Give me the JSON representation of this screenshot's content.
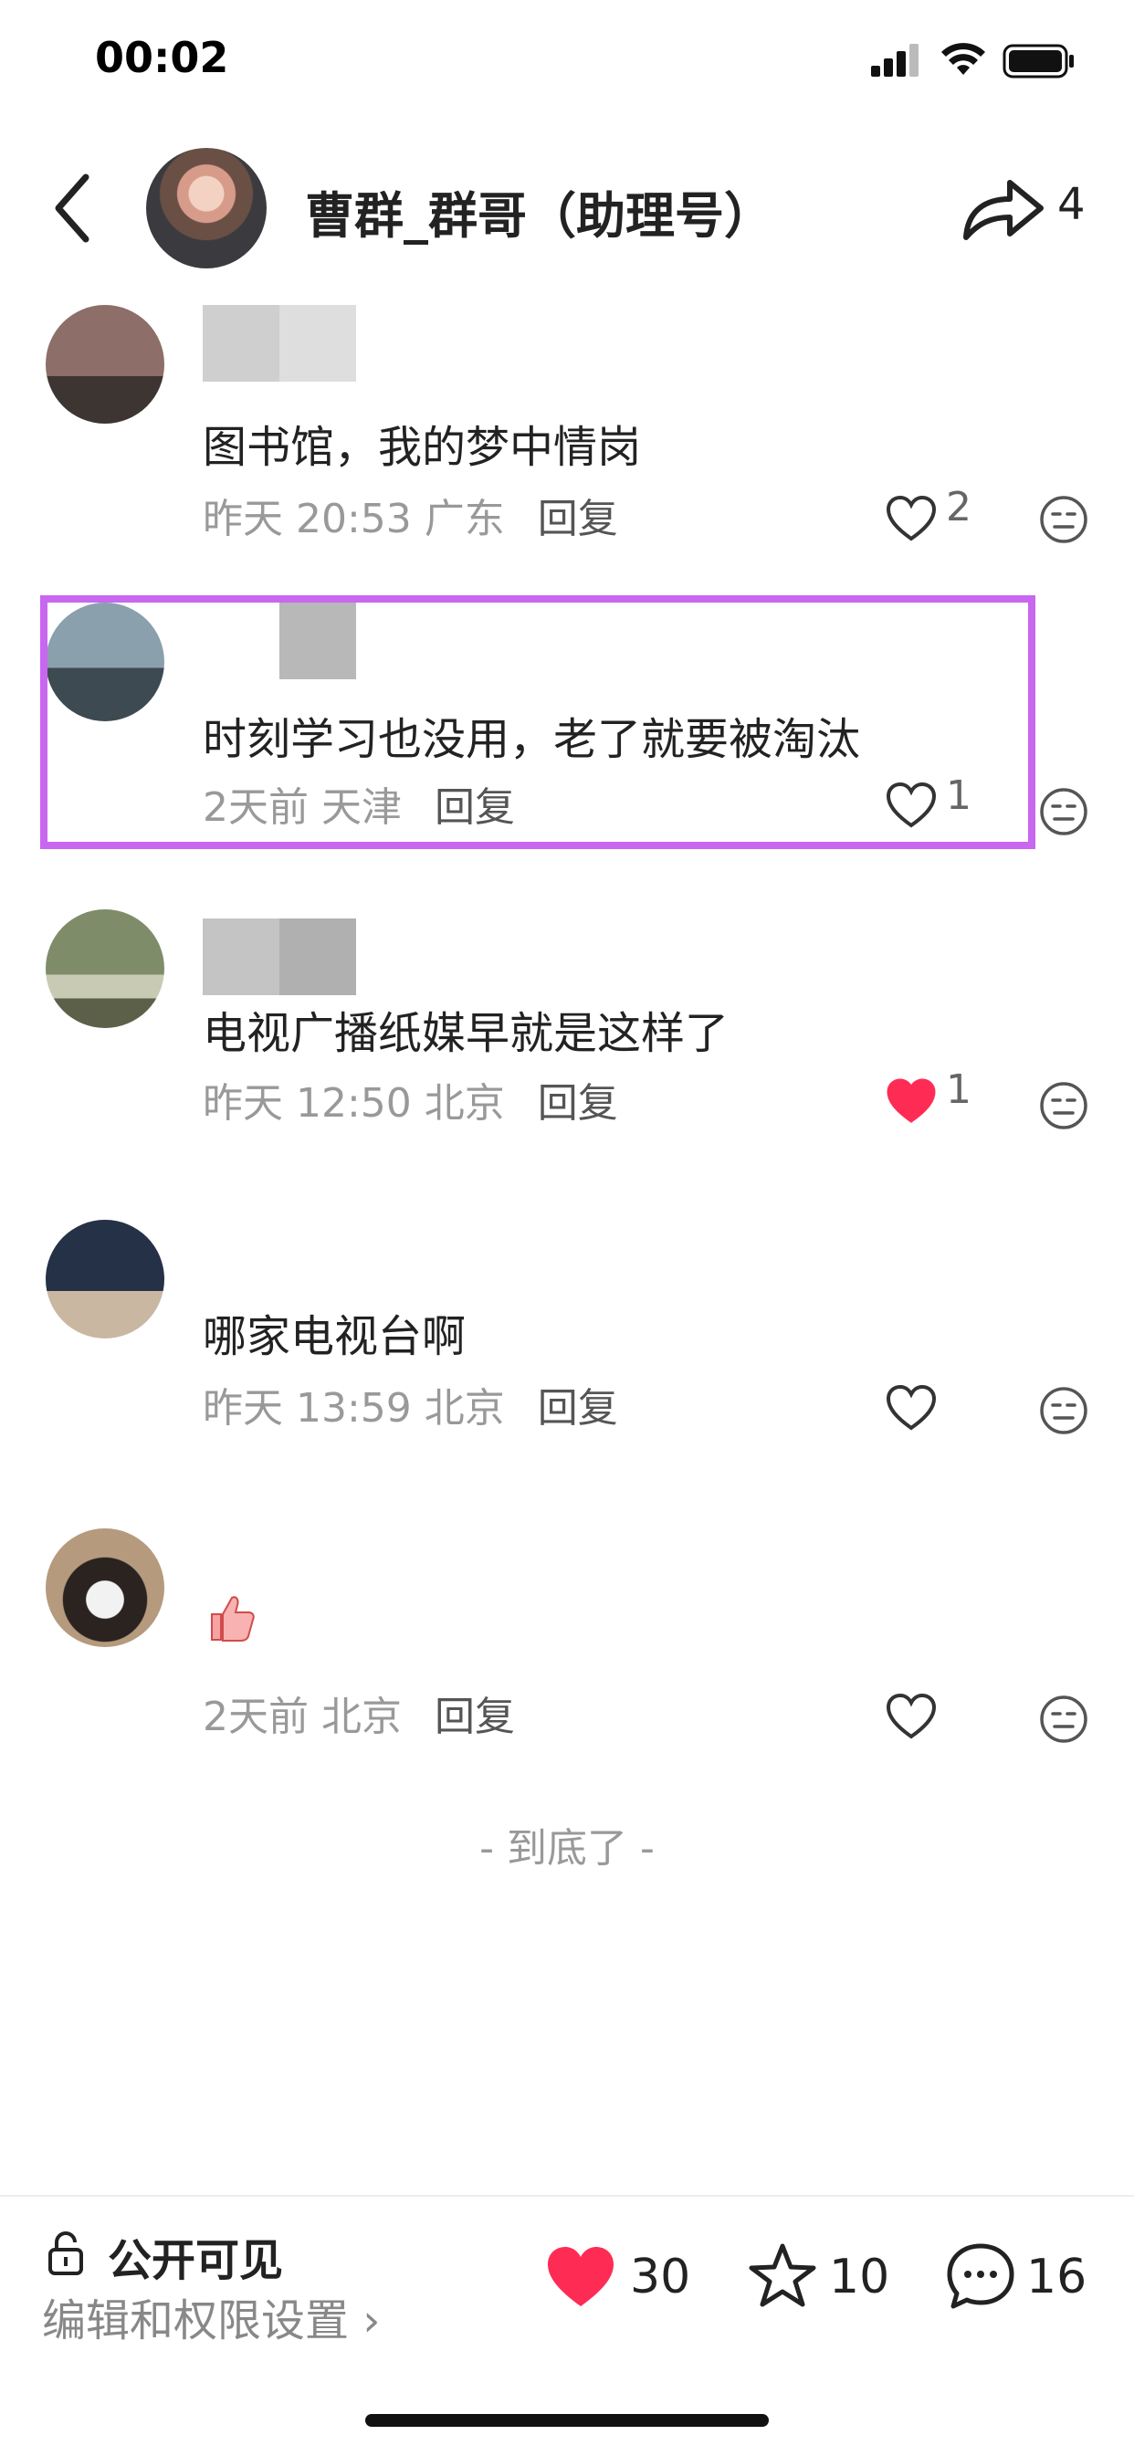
{
  "status_bar": {
    "time": "00:02"
  },
  "header": {
    "author_name": "曹群_群哥（助理号）",
    "share_count": "4"
  },
  "comments": [
    {
      "text": "图书馆，我的梦中情岗",
      "date": "昨天 20:53",
      "location": "广东",
      "reply_label": "回复",
      "likes": "2",
      "liked": false
    },
    {
      "text": "时刻学习也没用，老了就要被淘汰",
      "date": "2天前",
      "location": "天津",
      "reply_label": "回复",
      "likes": "1",
      "liked": false
    },
    {
      "text": "电视广播纸媒早就是这样了",
      "date": "昨天 12:50",
      "location": "北京",
      "reply_label": "回复",
      "likes": "1",
      "liked": true
    },
    {
      "text": "哪家电视台啊",
      "date": "昨天 13:59",
      "location": "北京",
      "reply_label": "回复",
      "likes": "",
      "liked": false
    },
    {
      "text": "",
      "date": "2天前",
      "location": "北京",
      "reply_label": "回复",
      "likes": "",
      "liked": false,
      "emoji": "thumbs-up"
    }
  ],
  "end_marker": "- 到底了 -",
  "footer": {
    "visibility": "公开可见",
    "permission_link": "编辑和权限设置 ›",
    "like_total": "30",
    "favorite_total": "10",
    "comment_total": "16"
  },
  "colors": {
    "accent_like": "#fe2c55",
    "highlight_border": "#c867f0"
  }
}
